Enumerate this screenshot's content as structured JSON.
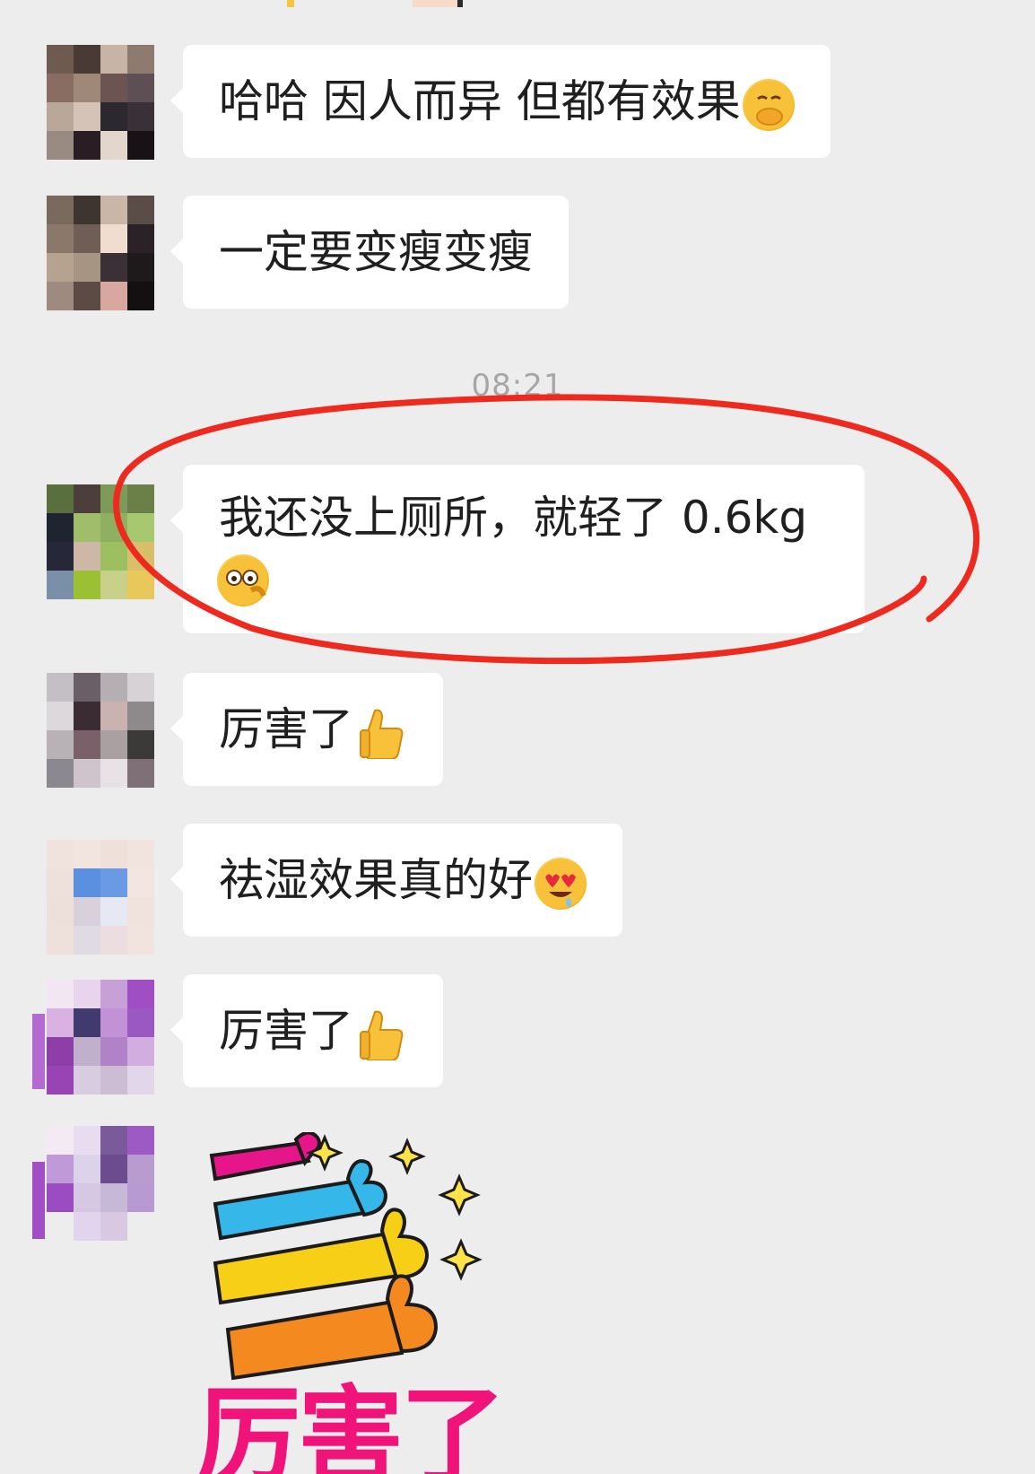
{
  "messages": [
    {
      "text": "哈哈 因人而异 但都有效果",
      "emoji": "face-with-hand-over-mouth-emoji"
    },
    {
      "text": "一定要变瘦变瘦"
    },
    {
      "text": "我还没上厕所，就轻了 0.6kg",
      "emoji": "peeking-face-emoji",
      "highlighted": true
    },
    {
      "text": "厉害了",
      "emoji": "thumbs-up-emoji"
    },
    {
      "text": "祛湿效果真的好",
      "emoji": "heart-eyes-emoji"
    },
    {
      "text": "厉害了",
      "emoji": "thumbs-up-emoji"
    }
  ],
  "timestamp": "08:21",
  "sticker": {
    "text": "厉害了",
    "colors": [
      "#e6168a",
      "#35b7ea",
      "#f7cf16",
      "#f4891f"
    ]
  },
  "annotation_color": "#ee2a1f"
}
